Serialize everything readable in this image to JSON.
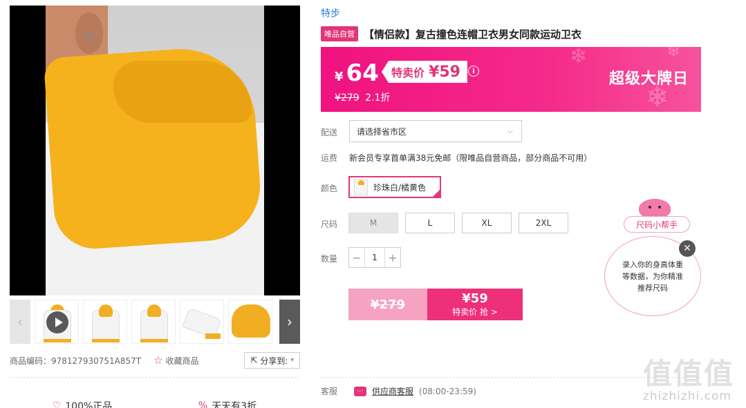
{
  "brand": "特步",
  "self_tag": "唯品自营",
  "title": "【情侣款】复古撞色连帽卫衣男女同款运动卫衣",
  "price_banner": {
    "yen": "¥",
    "price": "64",
    "special_label": "特卖价",
    "special_price": "¥59",
    "info": "i",
    "original_price": "¥279",
    "discount": "2.1折",
    "event_title": "超级大牌日"
  },
  "delivery": {
    "label": "配送",
    "placeholder": "请选择省市区"
  },
  "shipping": {
    "label": "运费",
    "text": "新会员专享首单满38元免邮（限唯品自营商品，部分商品不可用）"
  },
  "color": {
    "label": "颜色",
    "options": [
      "珍珠白/橘黄色"
    ]
  },
  "size": {
    "label": "尺码",
    "options": [
      "M",
      "L",
      "XL",
      "2XL"
    ]
  },
  "quantity": {
    "label": "数量",
    "value": "1",
    "minus": "−",
    "plus": "+"
  },
  "buy": {
    "original_price": "¥279",
    "price": "¥59",
    "label": "特卖价 抢 >"
  },
  "gallery": {
    "prev": "‹",
    "next": "›"
  },
  "meta": {
    "sku_code": "商品编码：978127930751A857T",
    "favorite": "收藏商品",
    "share": "分享到:"
  },
  "guarantees": [
    "100%正品",
    "天天有3折"
  ],
  "service": {
    "label": "客服",
    "link": "供应商客服",
    "hours": "(08:00-23:59)"
  },
  "size_helper": {
    "tag": "尺码小帮手",
    "text": "录入你的身高体重等数据，为你精准推荐尺码",
    "close": "✕"
  },
  "watermark": {
    "logo": "值值值",
    "url": "zhizhizhi.com"
  },
  "colors": {
    "accent": "#e2357a",
    "banner": "#f0127f",
    "link": "#2b7bd6"
  }
}
